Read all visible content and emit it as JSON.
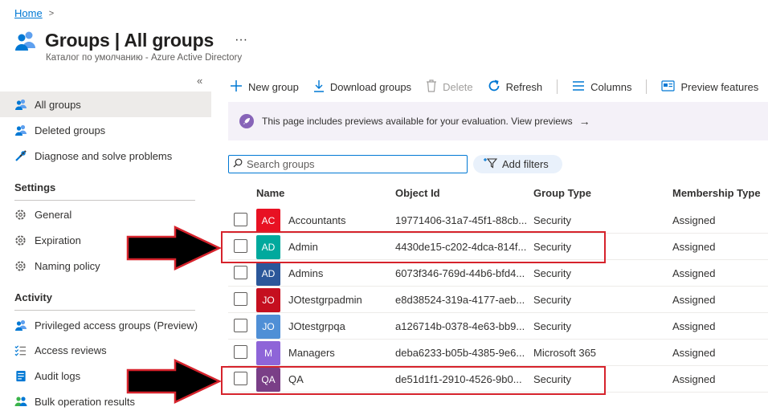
{
  "breadcrumb": {
    "home": "Home",
    "separator": ">"
  },
  "header": {
    "title": "Groups | All groups",
    "subtitle": "Каталог по умолчанию - Azure Active Directory",
    "more": "···"
  },
  "sidebar": {
    "collapse": "«",
    "items": [
      {
        "label": "All groups",
        "icon": "groups-icon",
        "active": true
      },
      {
        "label": "Deleted groups",
        "icon": "groups-icon"
      },
      {
        "label": "Diagnose and solve problems",
        "icon": "wrench-icon"
      }
    ],
    "sections": [
      {
        "heading": "Settings",
        "items": [
          {
            "label": "General",
            "icon": "gear-icon"
          },
          {
            "label": "Expiration",
            "icon": "gear-icon"
          },
          {
            "label": "Naming policy",
            "icon": "gear-icon"
          }
        ]
      },
      {
        "heading": "Activity",
        "items": [
          {
            "label": "Privileged access groups (Preview)",
            "icon": "groups-icon"
          },
          {
            "label": "Access reviews",
            "icon": "list-check-icon"
          },
          {
            "label": "Audit logs",
            "icon": "log-icon"
          },
          {
            "label": "Bulk operation results",
            "icon": "people-icon"
          }
        ]
      }
    ]
  },
  "toolbar": {
    "new_group": "New group",
    "download_groups": "Download groups",
    "delete": "Delete",
    "refresh": "Refresh",
    "columns": "Columns",
    "preview_features": "Preview features"
  },
  "banner": {
    "text": "This page includes previews available for your evaluation. View previews",
    "arrow": "→"
  },
  "search": {
    "placeholder": "Search groups",
    "value": ""
  },
  "filters": {
    "add_label": "Add filters"
  },
  "table": {
    "headers": {
      "name": "Name",
      "object_id": "Object Id",
      "group_type": "Group Type",
      "membership": "Membership Type"
    },
    "rows": [
      {
        "initials": "AC",
        "color": "#e81123",
        "name": "Accountants",
        "object_id": "19771406-31a7-45f1-88cb...",
        "group_type": "Security",
        "membership": "Assigned"
      },
      {
        "initials": "AD",
        "color": "#00a99d",
        "name": "Admin",
        "object_id": "4430de15-c202-4dca-814f...",
        "group_type": "Security",
        "membership": "Assigned"
      },
      {
        "initials": "AD",
        "color": "#2b579a",
        "name": "Admins",
        "object_id": "6073f346-769d-44b6-bfd4...",
        "group_type": "Security",
        "membership": "Assigned"
      },
      {
        "initials": "JO",
        "color": "#c50f1f",
        "name": "JOtestgrpadmin",
        "object_id": "e8d38524-319a-4177-aeb...",
        "group_type": "Security",
        "membership": "Assigned"
      },
      {
        "initials": "JO",
        "color": "#4f8fd6",
        "name": "JOtestgrpqa",
        "object_id": "a126714b-0378-4e63-bb9...",
        "group_type": "Security",
        "membership": "Assigned"
      },
      {
        "initials": "M",
        "color": "#8e65d8",
        "name": "Managers",
        "object_id": "deba6233-b05b-4385-9e6...",
        "group_type": "Microsoft 365",
        "membership": "Assigned"
      },
      {
        "initials": "QA",
        "color": "#7a3f87",
        "name": "QA",
        "object_id": "de51d1f1-2910-4526-9b0...",
        "group_type": "Security",
        "membership": "Assigned"
      }
    ]
  },
  "colors": {
    "accent": "#0078d4",
    "highlight": "#d6232c",
    "annotation_arrow": "#000000"
  }
}
